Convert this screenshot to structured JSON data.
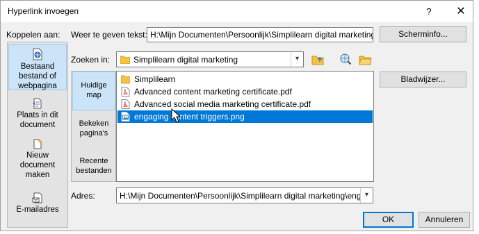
{
  "window": {
    "title": "Hyperlink invoegen",
    "help_label": "?",
    "close_label": "✕"
  },
  "link_to": {
    "label": "Koppelen aan:",
    "items": [
      {
        "label": "Bestaand bestand of webpagina",
        "icon": "globe-document-icon",
        "active": true
      },
      {
        "label": "Plaats in dit document",
        "icon": "document-place-icon",
        "active": false
      },
      {
        "label": "Nieuw document maken",
        "icon": "new-document-icon",
        "active": false
      },
      {
        "label": "E-mailadres",
        "icon": "email-icon",
        "active": false
      }
    ]
  },
  "display_text": {
    "label": "Weer te geven tekst:",
    "value": "H:\\Mijn Documenten\\Persoonlijk\\Simplilearn digital marketing\\"
  },
  "screentip_button": "Scherminfo...",
  "look_in": {
    "label": "Zoeken in:",
    "value": "Simplilearn digital marketing"
  },
  "view_tabs": [
    {
      "label": "Huidige map",
      "active": true
    },
    {
      "label": "Bekeken pagina's",
      "active": false
    },
    {
      "label": "Recente bestanden",
      "active": false
    }
  ],
  "files": [
    {
      "name": "Simplilearn",
      "type": "folder",
      "selected": false
    },
    {
      "name": "Advanced content marketing certificate.pdf",
      "type": "pdf",
      "selected": false
    },
    {
      "name": "Advanced social media marketing certificate.pdf",
      "type": "pdf",
      "selected": false
    },
    {
      "name": "engaging content triggers.png",
      "type": "png",
      "selected": true
    }
  ],
  "bookmark_button": "Bladwijzer...",
  "address": {
    "label": "Adres:",
    "value": "H:\\Mijn Documenten\\Persoonlijk\\Simplilearn digital marketing\\enga"
  },
  "ok_button": "OK",
  "cancel_button": "Annuleren",
  "colors": {
    "accent": "#0078d7",
    "selection_light": "#cce4f7",
    "dialog_bg": "#f0f0f0",
    "pdf_red": "#d32f2f",
    "folder_yellow": "#f5c342"
  }
}
